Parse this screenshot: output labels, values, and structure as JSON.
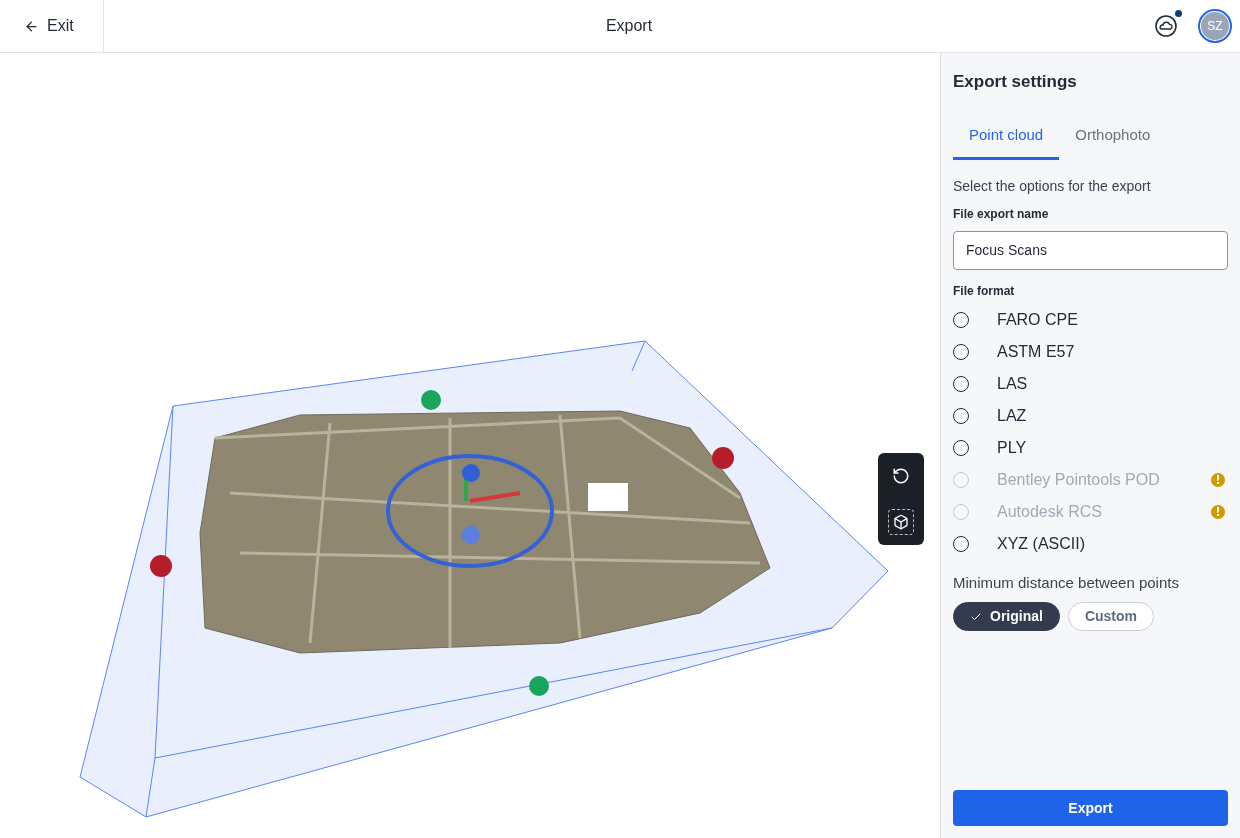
{
  "header": {
    "back": "Exit",
    "title": "Export",
    "avatar": "SZ",
    "cloud_notification": true
  },
  "panel": {
    "title": "Export settings",
    "tabs": [
      {
        "label": "Point cloud",
        "selected": true
      },
      {
        "label": "Orthophoto",
        "selected": false
      }
    ],
    "intro": "Select the options for the export",
    "name_label": "File export name",
    "name_value": "Focus Scans",
    "format_label": "File format",
    "formats": [
      {
        "label": "FARO CPE",
        "selected": false,
        "disabled": false,
        "warning": false
      },
      {
        "label": "ASTM E57",
        "selected": false,
        "disabled": false,
        "warning": false
      },
      {
        "label": "LAS",
        "selected": false,
        "disabled": false,
        "warning": false
      },
      {
        "label": "LAZ",
        "selected": false,
        "disabled": false,
        "warning": false
      },
      {
        "label": "PLY",
        "selected": false,
        "disabled": false,
        "warning": false
      },
      {
        "label": "Bentley Pointools POD",
        "selected": false,
        "disabled": true,
        "warning": true
      },
      {
        "label": "Autodesk RCS",
        "selected": false,
        "disabled": true,
        "warning": true
      },
      {
        "label": "XYZ (ASCII)",
        "selected": false,
        "disabled": false,
        "warning": false
      }
    ],
    "distance_label": "Minimum distance between points",
    "distance_options": [
      {
        "label": "Original",
        "selected": true
      },
      {
        "label": "Custom",
        "selected": false
      }
    ],
    "export_button": "Export"
  }
}
